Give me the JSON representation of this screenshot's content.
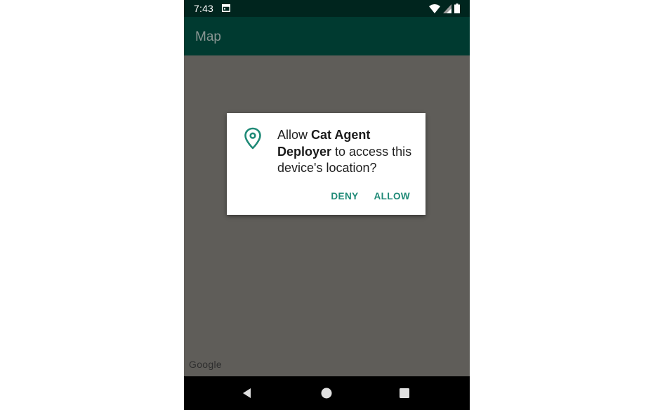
{
  "status_bar": {
    "time": "7:43",
    "notification_icon": "calendar-icon",
    "right_icons": [
      "wifi-icon",
      "signal-icon",
      "battery-icon"
    ]
  },
  "app_bar": {
    "title": "Map"
  },
  "map": {
    "attribution": "Google"
  },
  "permission_dialog": {
    "icon": "location-pin-icon",
    "message_prefix": "Allow ",
    "app_name": "Cat Agent Deployer",
    "message_suffix": " to access this device's location?",
    "deny_label": "DENY",
    "allow_label": "ALLOW",
    "accent_color": "#1f8a77"
  },
  "nav_bar": {
    "buttons": [
      "back-icon",
      "home-icon",
      "recents-icon"
    ]
  }
}
